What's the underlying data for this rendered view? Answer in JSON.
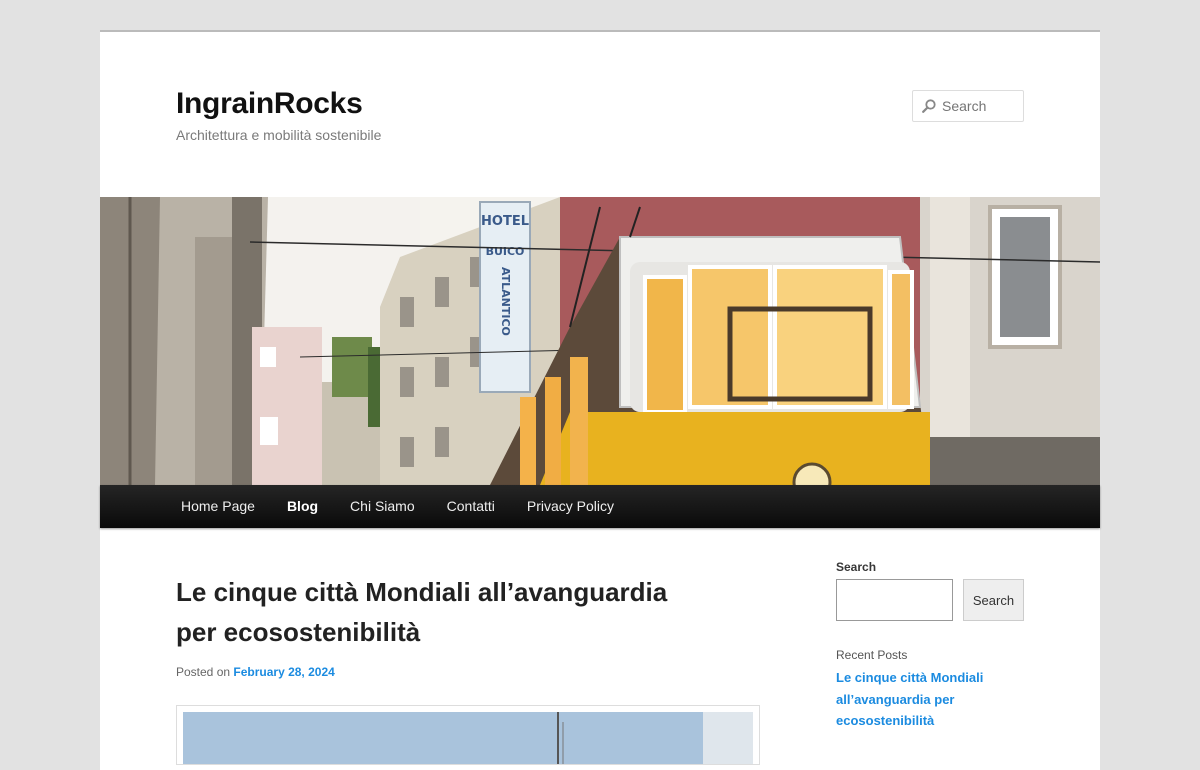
{
  "site": {
    "title": "IngrainRocks",
    "description": "Architettura e mobilità sostenibile"
  },
  "header_search": {
    "placeholder": "Search"
  },
  "nav": {
    "items": [
      {
        "label": "Home Page"
      },
      {
        "label": "Blog"
      },
      {
        "label": "Chi Siamo"
      },
      {
        "label": "Contatti"
      },
      {
        "label": "Privacy Policy"
      }
    ],
    "current": "Blog"
  },
  "header_image": {
    "hotel_sign": {
      "line1": "HOTEL",
      "line2": "BUICO",
      "line3": "ATLANTICO"
    }
  },
  "post": {
    "title_line1": "Le cinque città Mondiali all’avanguardia",
    "title_line2": "per ecosostenibilità",
    "meta_prefix": "Posted on",
    "date": "February 28, 2024"
  },
  "sidebar": {
    "search_label": "Search",
    "search_value": "",
    "search_button": "Search",
    "recent_title": "Recent Posts",
    "recent_posts": [
      {
        "line1": "Le cinque città Mondiali",
        "line2": "all’avanguardia per",
        "line3": "ecosostenibilità"
      }
    ]
  },
  "colors": {
    "background": "#e2e2e2",
    "link": "#1b8be0",
    "nav_bg": "#111111",
    "tram_yellow": "#e8b21f"
  },
  "icons": {
    "header_search": "magnifier-icon"
  }
}
